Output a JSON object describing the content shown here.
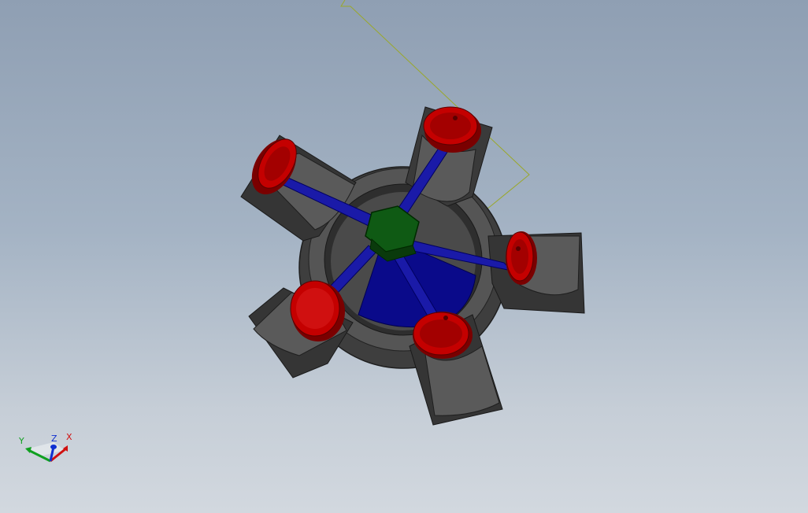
{
  "viewport": {
    "background_top": "#8f9fb3",
    "background_bottom": "#d2d8df"
  },
  "model": {
    "name": "radial-engine",
    "cylinder_count": 5,
    "colors": {
      "crankcase": "#4a4a4a",
      "crankcase_dark": "#2b2b2b",
      "crankcase_light": "#666666",
      "piston": "#c40000",
      "piston_dark": "#7a0000",
      "connecting_rod": "#1a1aa8",
      "crank_cone": "#0a0a8a",
      "master_hub": "#0f5a14",
      "sketch_line": "#9aa82a"
    }
  },
  "triad": {
    "x_label": "X",
    "y_label": "Y",
    "z_label": "Z",
    "x_color": "#d01010",
    "y_color": "#10a020",
    "z_color": "#1030d0"
  }
}
